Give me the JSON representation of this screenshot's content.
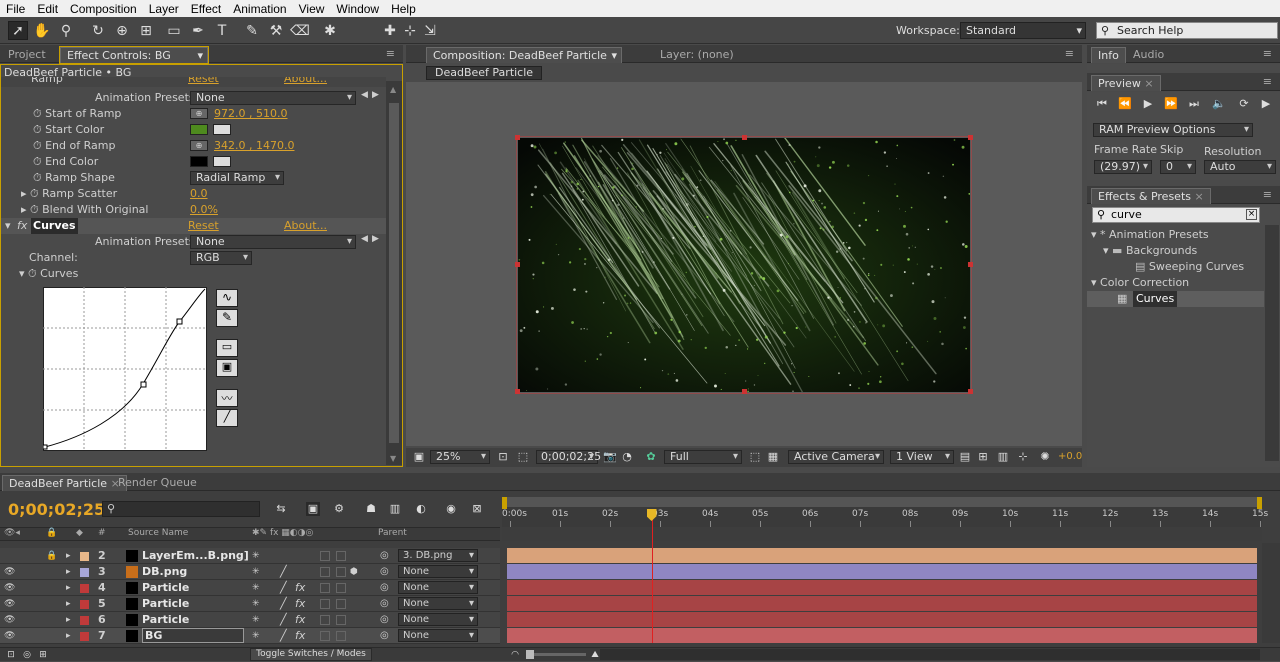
{
  "menu": [
    "File",
    "Edit",
    "Composition",
    "Layer",
    "Effect",
    "Animation",
    "View",
    "Window",
    "Help"
  ],
  "workspace": {
    "label": "Workspace:",
    "value": "Standard",
    "search_placeholder": "Search Help"
  },
  "left_panel": {
    "tabs": [
      "Project",
      "Effect Controls: BG"
    ],
    "subtitle": "DeadBeef Particle • BG",
    "ramp_header": "Ramp",
    "ramp_reset": "Reset",
    "ramp_about": "About...",
    "anim_presets_label": "Animation Presets:",
    "anim_presets_value": "None",
    "props": [
      {
        "label": "Start of Ramp",
        "value": "972.0 , 510.0"
      },
      {
        "label": "Start Color",
        "color": "#4e8a1e"
      },
      {
        "label": "End of Ramp",
        "value": "342.0 , 1470.0"
      },
      {
        "label": "End Color",
        "color": "#000000"
      },
      {
        "label": "Ramp Shape",
        "value": "Radial Ramp"
      },
      {
        "label": "Ramp Scatter",
        "value": "0.0"
      },
      {
        "label": "Blend With Original",
        "value": "0.0%"
      }
    ],
    "curves_header": "Curves",
    "curves_reset": "Reset",
    "curves_about": "About...",
    "curves_anim_label": "Animation Presets:",
    "curves_anim_value": "None",
    "channel_label": "Channel:",
    "channel_value": "RGB",
    "curves_prop": "Curves"
  },
  "comp_panel": {
    "tab": "Composition: DeadBeef Particle",
    "layer_tab": "Layer: (none)",
    "breadcrumb": "DeadBeef Particle",
    "zoom": "25%",
    "timecode": "0;00;02;25",
    "resolution": "Full",
    "camera": "Active Camera",
    "views": "1 View",
    "exposure": "+0.0"
  },
  "right_panel": {
    "tabs": [
      "Info",
      "Audio"
    ],
    "preview_tab": "Preview",
    "ram_preview": "RAM Preview Options",
    "frame_rate_label": "Frame Rate",
    "skip_label": "Skip",
    "resolution_label": "Resolution",
    "frame_rate": "(29.97)",
    "skip": "0",
    "resolution": "Auto",
    "effects_tab": "Effects & Presets",
    "search_value": "curve",
    "tree": [
      {
        "label": "* Animation Presets",
        "level": 0
      },
      {
        "label": "Backgrounds",
        "level": 1
      },
      {
        "label": "Sweeping Curves",
        "level": 2
      },
      {
        "label": "Color Correction",
        "level": 0
      },
      {
        "label": "Curves",
        "level": 1
      }
    ]
  },
  "timeline": {
    "tabs": [
      "DeadBeef Particle",
      "Render Queue"
    ],
    "timecode": "0;00;02;25",
    "col_source": "Source Name",
    "col_parent": "Parent",
    "col_hash": "#",
    "ruler": [
      "0:00s",
      "01s",
      "02s",
      "03s",
      "04s",
      "05s",
      "06s",
      "07s",
      "08s",
      "09s",
      "10s",
      "11s",
      "12s",
      "13s",
      "14s",
      "15s"
    ],
    "playhead_seconds": 2.83,
    "layers": [
      {
        "num": "2",
        "name": "LayerEm...B.png]",
        "label_color": "#e8b88a",
        "parent": "3. DB.png",
        "bar_color": "#d9a27a"
      },
      {
        "num": "3",
        "name": "DB.png",
        "label_color": "#a7a6d8",
        "parent": "None",
        "bar_color": "#8f86c2"
      },
      {
        "num": "4",
        "name": "Particle",
        "label_color": "#c03a3a",
        "parent": "None",
        "bar_color": "#a74445"
      },
      {
        "num": "5",
        "name": "Particle",
        "label_color": "#c03a3a",
        "parent": "None",
        "bar_color": "#a74445"
      },
      {
        "num": "6",
        "name": "Particle",
        "label_color": "#c03a3a",
        "parent": "None",
        "bar_color": "#a74445"
      },
      {
        "num": "7",
        "name": "BG",
        "label_color": "#c03a3a",
        "parent": "None",
        "bar_color": "#c25f62"
      }
    ],
    "toggle_label": "Toggle Switches / Modes"
  }
}
